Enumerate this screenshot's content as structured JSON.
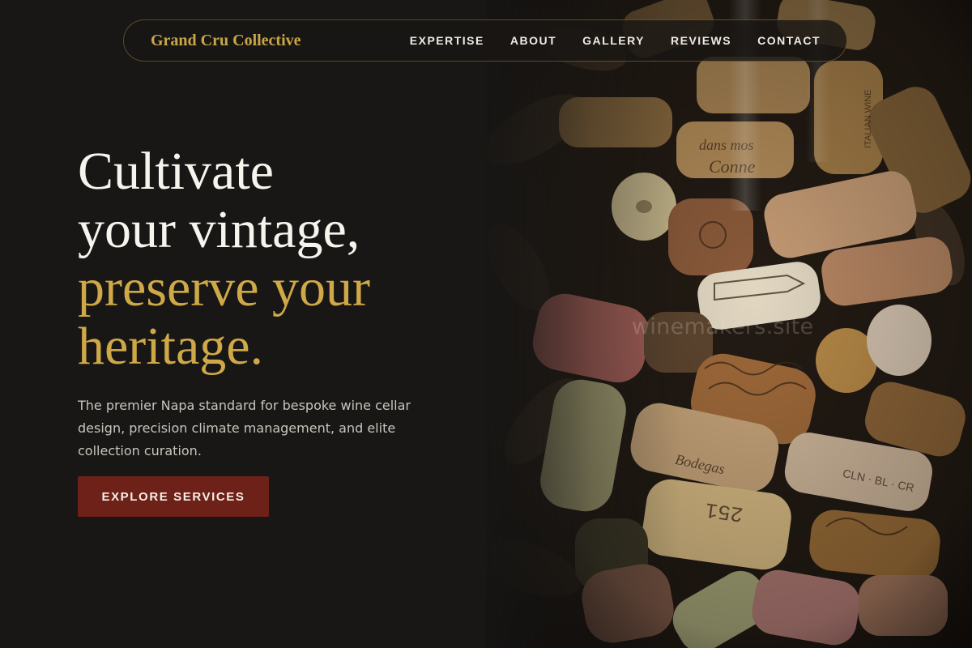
{
  "nav": {
    "brand": "Grand Cru Collective",
    "links": [
      "EXPERTISE",
      "ABOUT",
      "GALLERY",
      "REVIEWS",
      "CONTACT"
    ]
  },
  "hero": {
    "headline_lines": [
      "Cultivate",
      "your vintage,"
    ],
    "headline_accent_lines": [
      "preserve your",
      "heritage."
    ],
    "description": "The premier Napa standard for bespoke wine cellar design, precision climate management, and elite collection curation.",
    "cta_label": "EXPLORE SERVICES",
    "image_watermark": "winemakers.site",
    "image_subject": "pile of wine corks"
  },
  "colors": {
    "background": "#181716",
    "gold_accent": "#c9a648",
    "cta_background": "#6e2118",
    "body_text": "#c9c4bc"
  }
}
